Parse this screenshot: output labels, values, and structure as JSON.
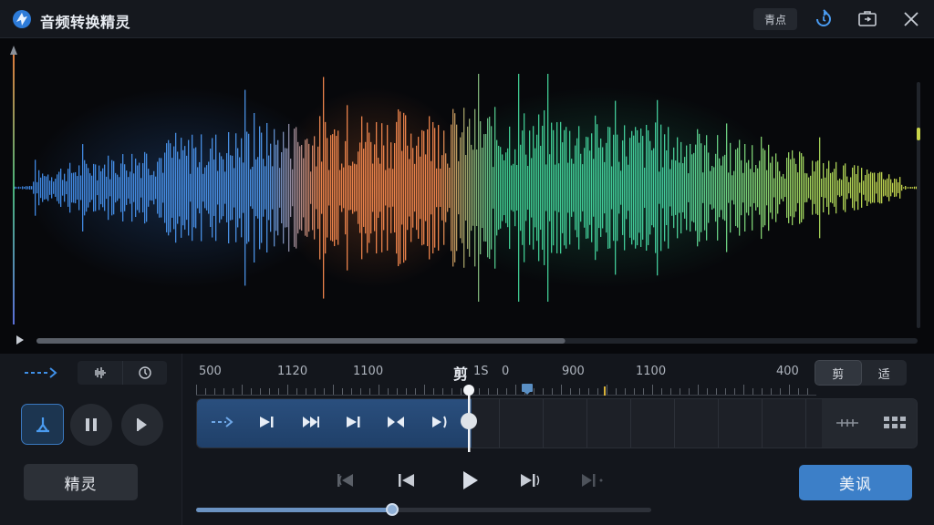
{
  "app": {
    "title": "音频转换精灵",
    "hotspot_label": "青点"
  },
  "waveform": {
    "colors": {
      "blue": "#4a8fe0",
      "orange": "#e8814a",
      "green": "#3fc98f",
      "yellow_green": "#b7d24d"
    },
    "scroll_position": 0.6
  },
  "controls": {
    "left": {
      "elf_label": "精灵"
    },
    "ruler": {
      "labels": [
        "500",
        "1120",
        "1100",
        "剪",
        "1S",
        "0",
        "900",
        "1100",
        "400"
      ],
      "center_label": "剪"
    },
    "mode_toggle": {
      "options": [
        "剪",
        "适"
      ],
      "selected": 0
    },
    "primary_action_label": "美讽",
    "playback_progress": 0.43,
    "clip_progress": 0.38
  },
  "icons": {
    "logo": "app-logo-icon",
    "sync": "sync-icon",
    "window_mode": "window-mode-icon",
    "close": "close-icon"
  },
  "accent_color": "#3c7fc8"
}
